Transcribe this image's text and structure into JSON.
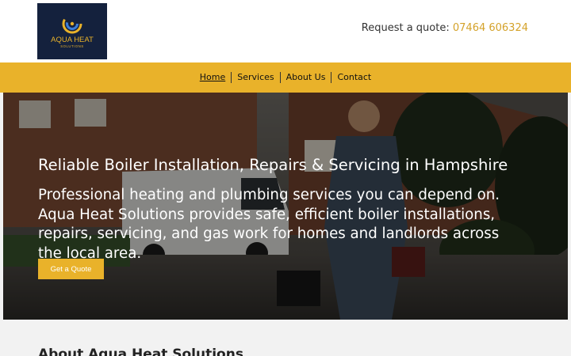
{
  "header": {
    "logo": {
      "title": "AQUA HEAT",
      "subtitle": "SOLUTIONS",
      "icon": "swirl-logo-icon"
    },
    "quote_label": "Request a quote:",
    "phone": "07464 606324"
  },
  "nav": {
    "items": [
      {
        "label": "Home",
        "active": true
      },
      {
        "label": "Services"
      },
      {
        "label": "About Us"
      },
      {
        "label": "Contact"
      }
    ]
  },
  "hero": {
    "title": "Reliable Boiler Installation, Repairs & Servicing in Hampshire",
    "text": "Professional heating and plumbing services you can depend on. Aqua Heat Solutions provides safe, efficient boiler installations, repairs, servicing, and gas work for homes and landlords across the local area.",
    "button_label": "Get a Quote"
  },
  "about": {
    "heading": "About Aqua Heat Solutions"
  },
  "colors": {
    "accent": "#e9b22a",
    "logo_bg": "#14213d",
    "phone": "#d4a22a"
  }
}
